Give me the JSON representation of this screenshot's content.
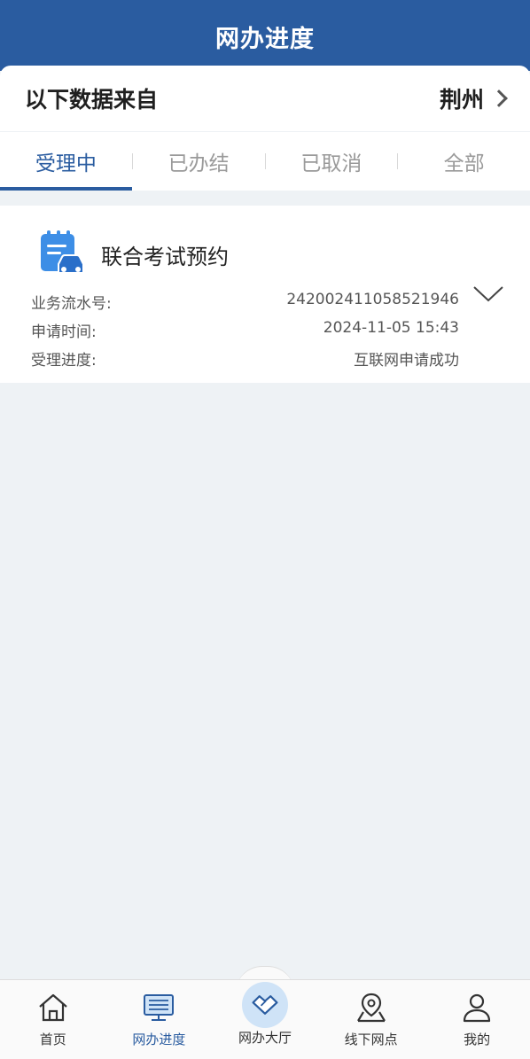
{
  "header": {
    "title": "网办进度"
  },
  "source": {
    "label": "以下数据来自",
    "city": "荆州"
  },
  "tabs": [
    {
      "label": "受理中",
      "active": true
    },
    {
      "label": "已办结",
      "active": false
    },
    {
      "label": "已取消",
      "active": false
    },
    {
      "label": "全部",
      "active": false
    }
  ],
  "record": {
    "service_name": "联合考试预约",
    "serial_label": "业务流水号:",
    "serial_value": "242002411058521946",
    "time_label": "申请时间:",
    "time_value": "2024-11-05 15:43",
    "progress_label": "受理进度:",
    "progress_value": "互联网申请成功"
  },
  "nav": [
    {
      "label": "首页",
      "icon": "home-icon"
    },
    {
      "label": "网办进度",
      "icon": "monitor-icon",
      "active": true
    },
    {
      "label": "网办大厅",
      "icon": "handshake-icon"
    },
    {
      "label": "线下网点",
      "icon": "map-pin-icon"
    },
    {
      "label": "我的",
      "icon": "user-icon"
    }
  ],
  "colors": {
    "primary": "#2a5ca0",
    "background": "#eef2f5"
  }
}
